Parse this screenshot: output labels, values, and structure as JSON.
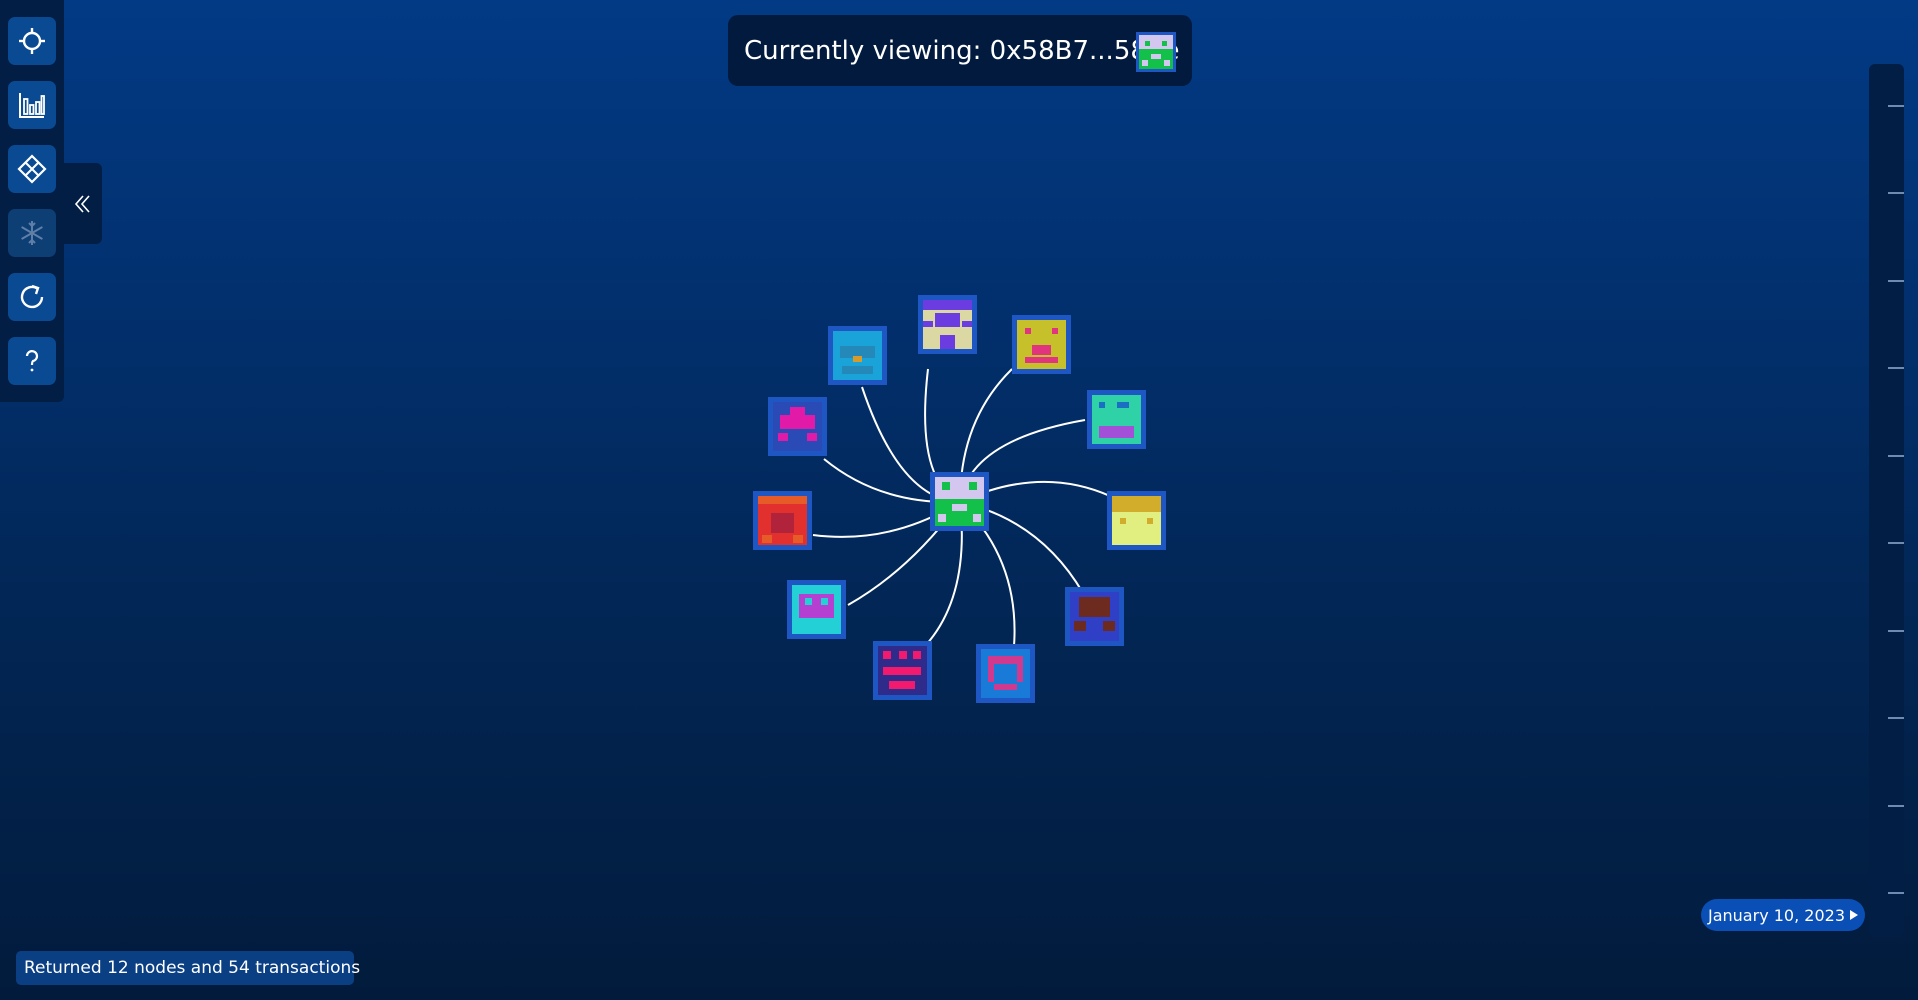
{
  "header": {
    "viewing_text": "Currently viewing: 0x58B7...587e"
  },
  "toolbar": {
    "items": [
      {
        "name": "crosshair-icon",
        "enabled": true
      },
      {
        "name": "bar-chart-icon",
        "enabled": true
      },
      {
        "name": "diamond-grid-icon",
        "enabled": true
      },
      {
        "name": "snowflake-icon",
        "enabled": false
      },
      {
        "name": "refresh-icon",
        "enabled": true
      },
      {
        "name": "help-icon",
        "enabled": true
      }
    ],
    "collapse_icon": "double-chevron-left-icon"
  },
  "graph": {
    "center_node": {
      "label": "0x58B7...587e"
    },
    "neighbor_count": 11
  },
  "timeline": {
    "date_label": "January 10, 2023"
  },
  "status": {
    "text": "Returned 12 nodes and 54 transactions"
  },
  "colors": {
    "node_border": "#1e56c4",
    "edge": "#ffffff",
    "accent": "#0a4fb5"
  }
}
